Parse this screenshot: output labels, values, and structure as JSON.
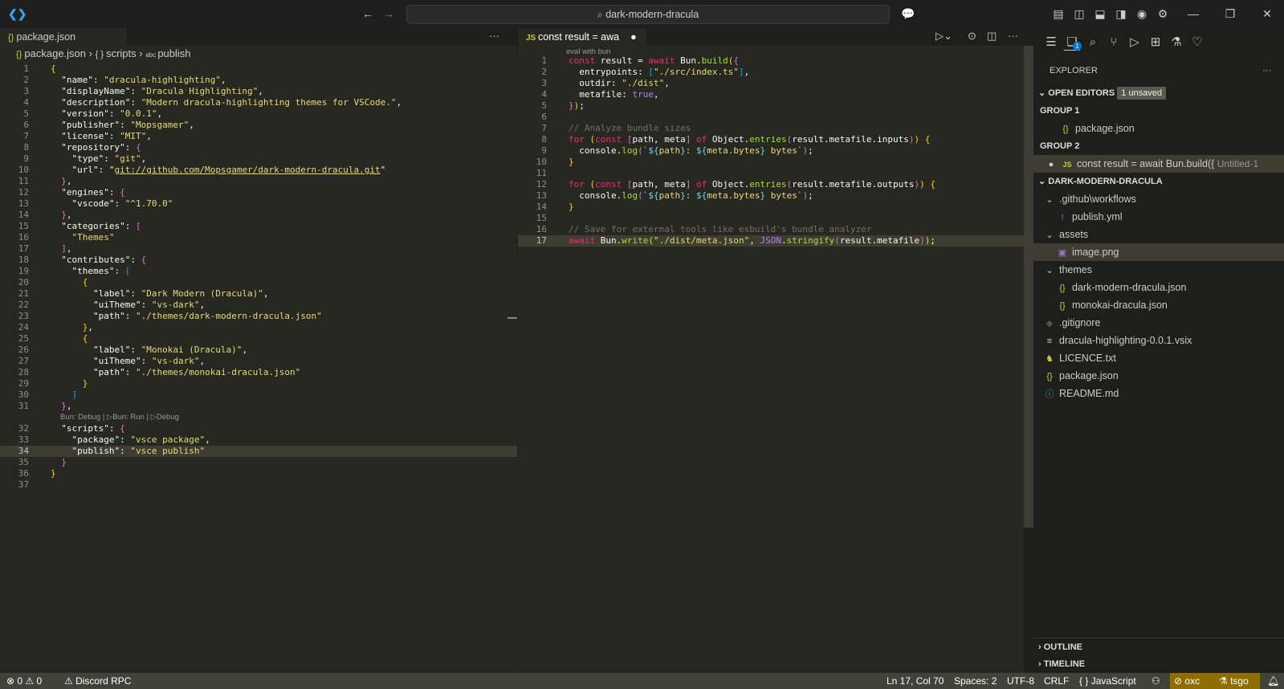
{
  "title": {
    "search": "dark-modern-dracula"
  },
  "left": {
    "tab": "package.json",
    "breadcrumb": [
      "package.json",
      "scripts",
      "publish"
    ],
    "codelens": "Bun: Debug | ▷Bun: Run | ▷Debug",
    "current_line": 34,
    "lines": [
      "{",
      "  \"name\": \"dracula-highlighting\",",
      "  \"displayName\": \"Dracula Highlighting\",",
      "  \"description\": \"Modern dracula-highlighting themes for VSCode.\",",
      "  \"version\": \"0.0.1\",",
      "  \"publisher\": \"Mopsgamer\",",
      "  \"license\": \"MIT\",",
      "  \"repository\": {",
      "    \"type\": \"git\",",
      "    \"url\": \"git://github.com/Mopsgamer/dark-modern-dracula.git\"",
      "  },",
      "  \"engines\": {",
      "    \"vscode\": \"^1.70.0\"",
      "  },",
      "  \"categories\": [",
      "    \"Themes\"",
      "  ],",
      "  \"contributes\": {",
      "    \"themes\": [",
      "      {",
      "        \"label\": \"Dark Modern (Dracula)\",",
      "        \"uiTheme\": \"vs-dark\",",
      "        \"path\": \"./themes/dark-modern-dracula.json\"",
      "      },",
      "      {",
      "        \"label\": \"Monokai (Dracula)\",",
      "        \"uiTheme\": \"vs-dark\",",
      "        \"path\": \"./themes/monokai-dracula.json\"",
      "      }",
      "    ]",
      "  },",
      "  \"scripts\": {",
      "    \"package\": \"vsce package\",",
      "    \"publish\": \"vsce publish\"",
      "  }",
      "}",
      ""
    ]
  },
  "right": {
    "tab": "const result = awa",
    "codelens": "eval with bun",
    "current_line": 17,
    "lines": [
      "const result = await Bun.build({",
      "  entrypoints: [\"./src/index.ts\"],",
      "  outdir: \"./dist\",",
      "  metafile: true,",
      "});",
      "",
      "// Analyze bundle sizes",
      "for (const [path, meta] of Object.entries(result.metafile.inputs)) {",
      "  console.log(`${path}: ${meta.bytes} bytes`);",
      "}",
      "",
      "for (const [path, meta] of Object.entries(result.metafile.outputs)) {",
      "  console.log(`${path}: ${meta.bytes} bytes`);",
      "}",
      "",
      "// Save for external tools like esbuild's bundle analyzer",
      "await Bun.write(\"./dist/meta.json\", JSON.stringify(result.metafile));"
    ]
  },
  "explorer": {
    "title": "EXPLORER",
    "badge": "1",
    "open_editors": "OPEN EDITORS",
    "unsaved": "1 unsaved",
    "group1": "GROUP 1",
    "group1_file": "package.json",
    "group2": "GROUP 2",
    "group2_file": "const result = await Bun.build({",
    "group2_desc": "Untitled-1",
    "folder": "DARK-MODERN-DRACULA",
    "tree": [
      {
        "label": ".github\\workflows",
        "icon": "chevron-down",
        "depth": 0
      },
      {
        "label": "publish.yml",
        "icon": "yaml",
        "depth": 1
      },
      {
        "label": "assets",
        "icon": "chevron-down",
        "depth": 0
      },
      {
        "label": "image.png",
        "icon": "image",
        "depth": 1
      },
      {
        "label": "themes",
        "icon": "chevron-down",
        "depth": 0
      },
      {
        "label": "dark-modern-dracula.json",
        "icon": "json",
        "depth": 1
      },
      {
        "label": "monokai-dracula.json",
        "icon": "json",
        "depth": 1
      },
      {
        "label": ".gitignore",
        "icon": "git",
        "depth": 0
      },
      {
        "label": "dracula-highlighting-0.0.1.vsix",
        "icon": "lines",
        "depth": 0
      },
      {
        "label": "LICENCE.txt",
        "icon": "licence",
        "depth": 0
      },
      {
        "label": "package.json",
        "icon": "json",
        "depth": 0
      },
      {
        "label": "README.md",
        "icon": "info",
        "depth": 0
      }
    ],
    "outline": "OUTLINE",
    "timeline": "TIMELINE"
  },
  "status": {
    "errors": "0",
    "warnings": "0",
    "discord": "Discord RPC",
    "position": "Ln 17, Col 70",
    "spaces": "Spaces: 2",
    "encoding": "UTF-8",
    "eol": "CRLF",
    "language": "JavaScript",
    "oxc": "oxc",
    "tsgo": "tsgo"
  }
}
